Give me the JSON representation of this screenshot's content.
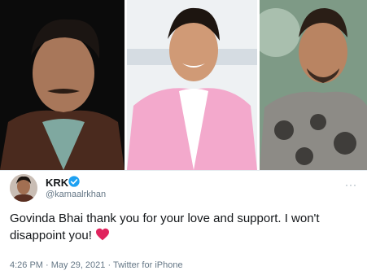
{
  "photos": {
    "left_alt": "KRK portrait",
    "center_alt": "Govinda in pink blazer",
    "right_alt": "Salman Khan in tie-dye shirt"
  },
  "tweet": {
    "name": "KRK",
    "handle": "@kamaalrkhan",
    "text": "Govinda Bhai thank you for your love and support. I won't disappoint you!",
    "timestamp": "4:26 PM · May 29, 2021 · Twitter for iPhone",
    "more_icon": "···"
  },
  "colors": {
    "verified": "#1da1f2",
    "heart": "#e0245e",
    "text": "#14171a",
    "muted": "#657786"
  }
}
